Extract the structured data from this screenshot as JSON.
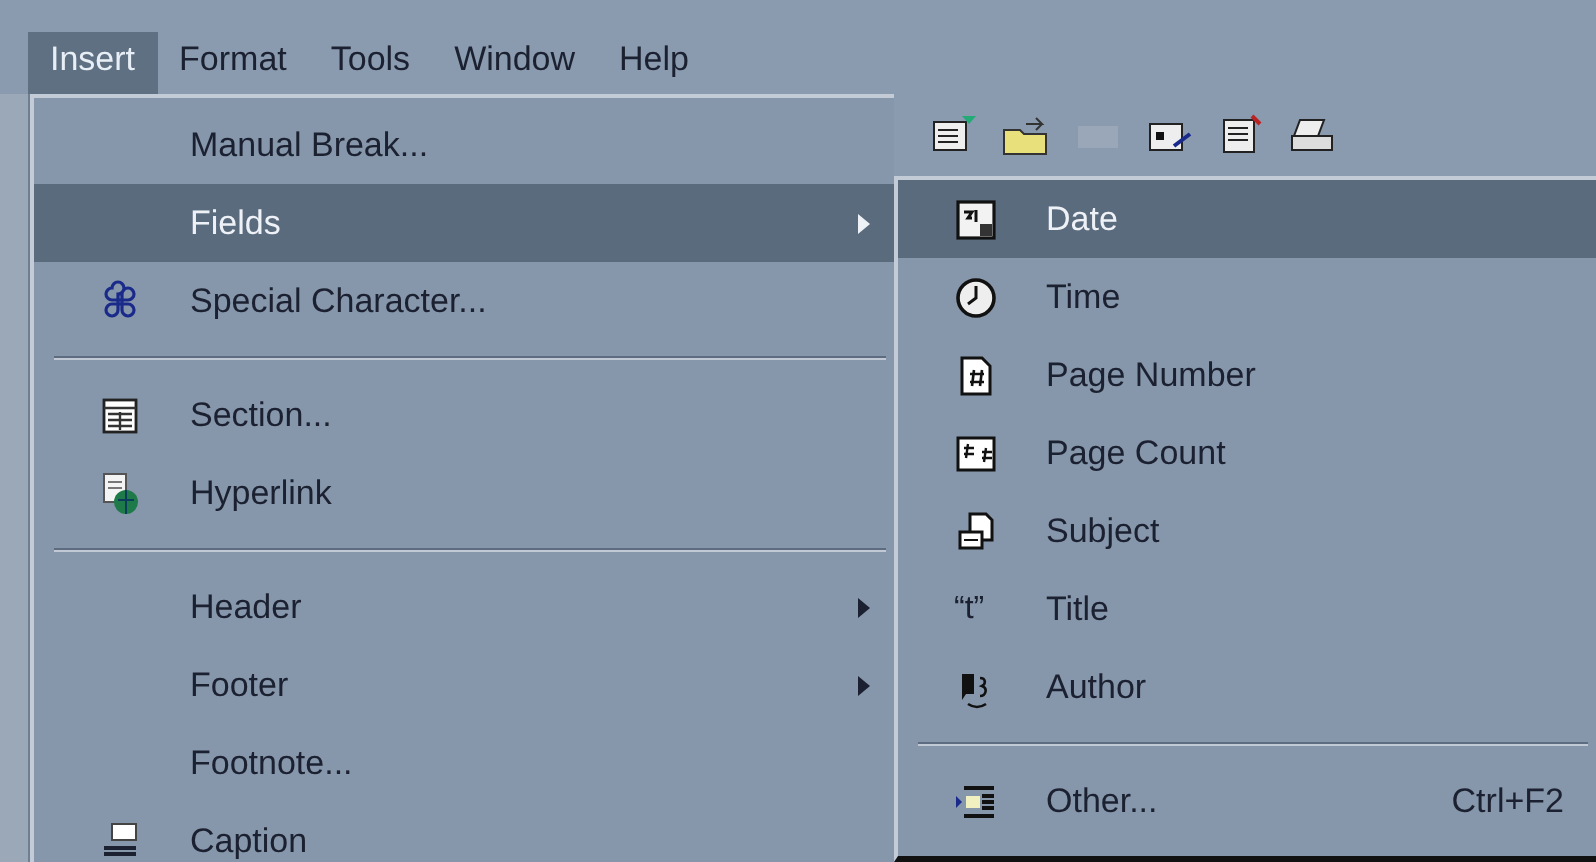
{
  "menu_bar": [
    {
      "label": "Insert",
      "selected": true
    },
    {
      "label": "Format",
      "selected": false
    },
    {
      "label": "Tools",
      "selected": false
    },
    {
      "label": "Window",
      "selected": false
    },
    {
      "label": "Help",
      "selected": false
    }
  ],
  "insert_menu": [
    {
      "kind": "item",
      "label": "Manual Break...",
      "selected": false,
      "submenu": false
    },
    {
      "kind": "item",
      "label": "Fields",
      "selected": true,
      "submenu": true
    },
    {
      "kind": "item",
      "label": "Special Character...",
      "selected": false,
      "submenu": false
    },
    {
      "kind": "separator"
    },
    {
      "kind": "item",
      "label": "Section...",
      "selected": false,
      "submenu": false
    },
    {
      "kind": "item",
      "label": "Hyperlink",
      "selected": false,
      "submenu": false
    },
    {
      "kind": "separator"
    },
    {
      "kind": "item",
      "label": "Header",
      "selected": false,
      "submenu": true
    },
    {
      "kind": "item",
      "label": "Footer",
      "selected": false,
      "submenu": true
    },
    {
      "kind": "item",
      "label": "Footnote...",
      "selected": false,
      "submenu": false
    },
    {
      "kind": "item",
      "label": "Caption",
      "selected": false,
      "submenu": false
    }
  ],
  "fields_menu": [
    {
      "kind": "item",
      "label": "Date",
      "selected": true
    },
    {
      "kind": "item",
      "label": "Time",
      "selected": false
    },
    {
      "kind": "item",
      "label": "Page Number",
      "selected": false
    },
    {
      "kind": "item",
      "label": "Page Count",
      "selected": false
    },
    {
      "kind": "item",
      "label": "Subject",
      "selected": false
    },
    {
      "kind": "item",
      "label": "Title",
      "selected": false,
      "glyph": "“t”"
    },
    {
      "kind": "item",
      "label": "Author",
      "selected": false
    },
    {
      "kind": "separator"
    },
    {
      "kind": "item",
      "label": "Other...",
      "selected": false,
      "shortcut": "Ctrl+F2"
    }
  ]
}
